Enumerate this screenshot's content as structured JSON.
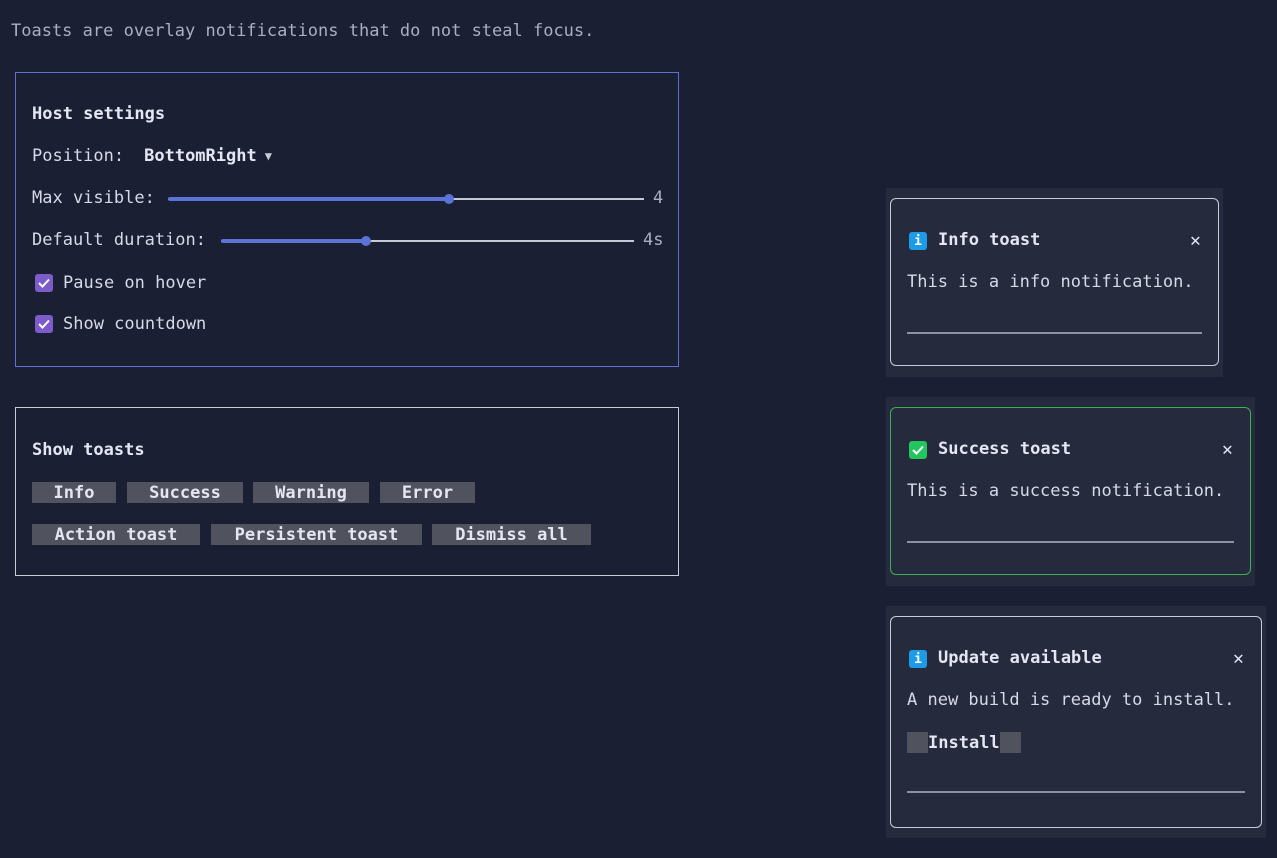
{
  "hint": "Toasts are overlay notifications that do not steal focus.",
  "host_settings": {
    "title": "Host settings",
    "position_label": "Position:",
    "position_value": "BottomRight",
    "max_visible_label": "Max visible:",
    "max_visible_value": "4",
    "max_visible_fraction": 0.59,
    "duration_label": "Default duration:",
    "duration_value": "4s",
    "duration_fraction": 0.35,
    "pause_on_hover_label": "Pause on hover",
    "pause_on_hover_checked": true,
    "show_countdown_label": "Show countdown",
    "show_countdown_checked": true
  },
  "show_toasts": {
    "title": "Show toasts",
    "buttons": [
      "Info",
      "Success",
      "Warning",
      "Error",
      "Action toast",
      "Persistent toast",
      "Dismiss all"
    ]
  },
  "toasts": [
    {
      "kind": "info",
      "icon": "info-icon",
      "title": "Info toast",
      "message": "This is a info notification.",
      "close": "✕"
    },
    {
      "kind": "success",
      "icon": "check-icon",
      "title": "Success toast",
      "message": "This is a success notification.",
      "close": "✕"
    },
    {
      "kind": "info",
      "icon": "info-icon",
      "title": "Update available",
      "message": "A new build is ready to install.",
      "action": "Install",
      "close": "✕"
    }
  ],
  "colors": {
    "background": "#1b1f33",
    "accent": "#5b73d6",
    "checkbox": "#7b5cc9",
    "info": "#1e9be6",
    "success": "#22c55e",
    "success_border": "#3fae55"
  }
}
